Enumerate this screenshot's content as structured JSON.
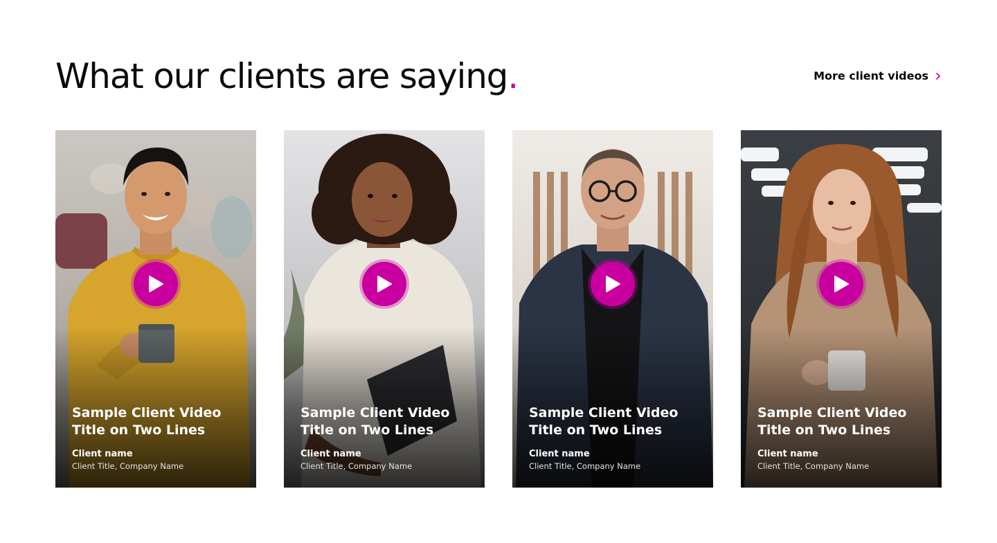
{
  "header": {
    "title": "What our clients are saying",
    "title_dot": ".",
    "more_link_label": "More client videos",
    "accent_color": "#c400a8"
  },
  "cards": [
    {
      "title_line1": "Sample Client Video",
      "title_line2": "Title on Two Lines",
      "client_name": "Client name",
      "client_meta": "Client Title, Company Name"
    },
    {
      "title_line1": "Sample Client Video",
      "title_line2": "Title on Two Lines",
      "client_name": "Client name",
      "client_meta": "Client Title, Company Name"
    },
    {
      "title_line1": "Sample Client Video",
      "title_line2": "Title on Two Lines",
      "client_name": "Client name",
      "client_meta": "Client Title, Company Name"
    },
    {
      "title_line1": "Sample Client Video",
      "title_line2": "Title on Two Lines",
      "client_name": "Client name",
      "client_meta": "Client Title, Company Name"
    }
  ],
  "icons": {
    "play": "play-icon",
    "chevron": "chevron-right-icon"
  }
}
